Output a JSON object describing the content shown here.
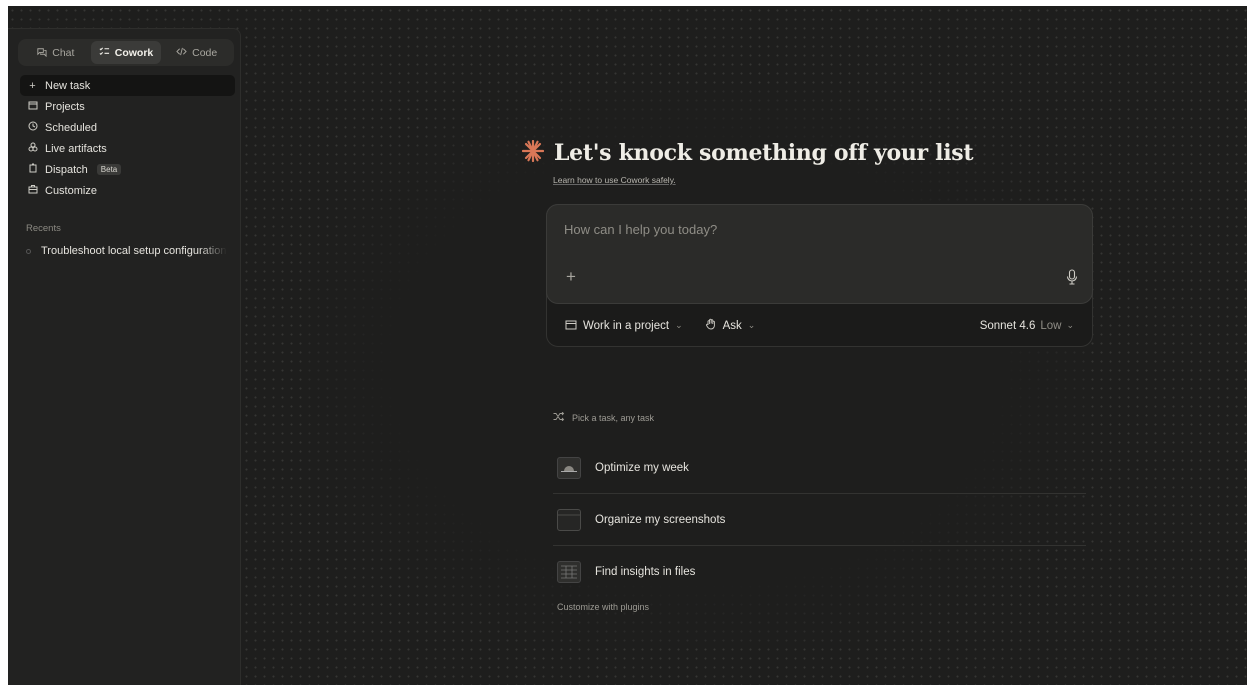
{
  "sidebar": {
    "modes": [
      {
        "label": "Chat",
        "icon": "chat-icon"
      },
      {
        "label": "Cowork",
        "icon": "cowork-icon",
        "active": true
      },
      {
        "label": "Code",
        "icon": "code-icon"
      }
    ],
    "nav": [
      {
        "label": "New task",
        "icon": "plus-icon"
      },
      {
        "label": "Projects",
        "icon": "folder-icon"
      },
      {
        "label": "Scheduled",
        "icon": "clock-icon"
      },
      {
        "label": "Live artifacts",
        "icon": "artifacts-icon"
      },
      {
        "label": "Dispatch",
        "icon": "dispatch-icon",
        "badge": "Beta"
      },
      {
        "label": "Customize",
        "icon": "briefcase-icon"
      }
    ],
    "recents_label": "Recents",
    "recents": [
      {
        "label": "Troubleshoot local setup configuration"
      }
    ]
  },
  "main": {
    "heading": "Let's knock something off your list",
    "learn_link": "Learn how to use Cowork safely.",
    "composer": {
      "placeholder": "How can I help you today?",
      "project_button": "Work in a project",
      "mode_button": "Ask",
      "model": "Sonnet 4.6",
      "effort": "Low"
    },
    "pick_label": "Pick a task, any task",
    "tasks": [
      {
        "label": "Optimize my week",
        "icon": "sunrise-icon"
      },
      {
        "label": "Organize my screenshots",
        "icon": "folder-icon"
      },
      {
        "label": "Find insights in files",
        "icon": "spreadsheet-icon"
      }
    ],
    "plugins_link": "Customize with plugins"
  },
  "colors": {
    "background": "#1e1e1d",
    "sidebar": "#222221",
    "accent": "#d97757"
  }
}
